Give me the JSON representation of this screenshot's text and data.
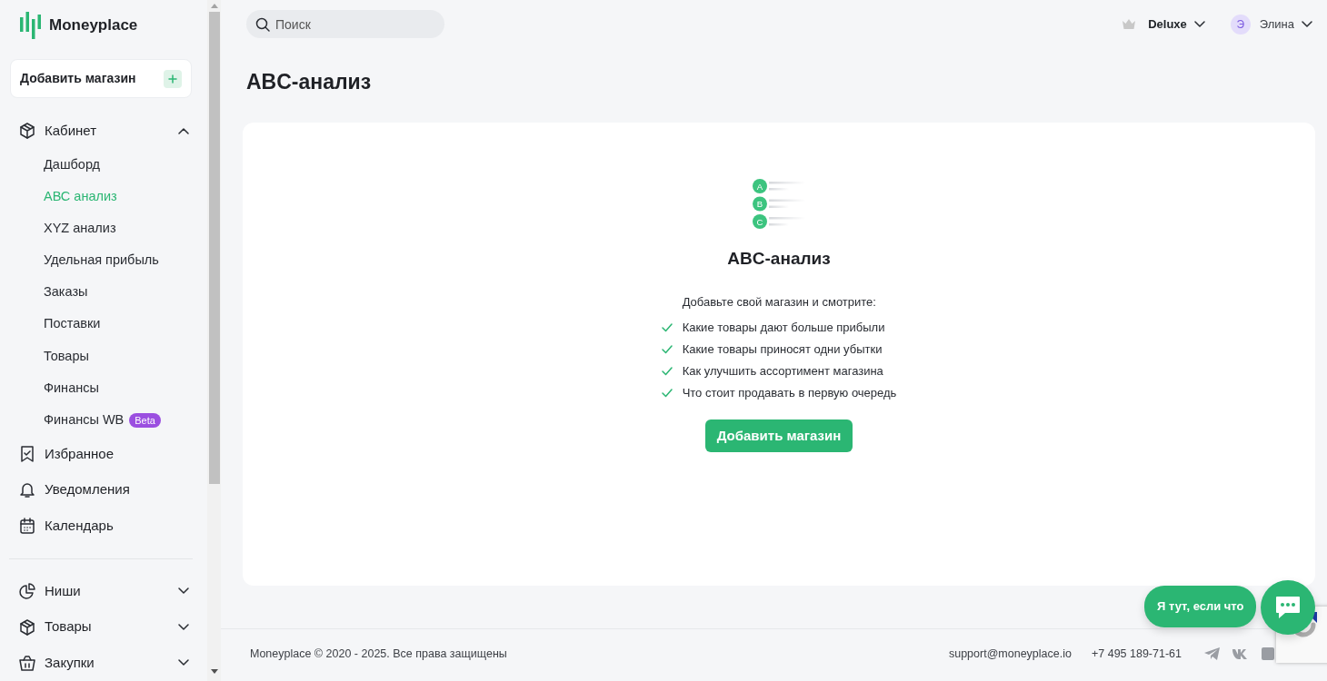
{
  "sidebar": {
    "logo": "Moneyplace",
    "add_store_button": "Добавить магазин",
    "nav_top": [
      {
        "label": "Кабинет",
        "kind": "group",
        "expanded": true,
        "children": [
          {
            "label": "Дашборд",
            "selected": false
          },
          {
            "label": "АВС анализ",
            "selected": true
          },
          {
            "label": "XYZ анализ",
            "selected": false
          },
          {
            "label": "Удельная прибыль",
            "selected": false
          },
          {
            "label": "Заказы",
            "selected": false
          },
          {
            "label": "Поставки",
            "selected": false
          },
          {
            "label": "Товары",
            "selected": false
          },
          {
            "label": "Финансы",
            "selected": false
          },
          {
            "label": "Финансы WB",
            "badge": "Beta",
            "selected": false
          }
        ]
      },
      {
        "label": "Избранное",
        "kind": "link"
      },
      {
        "label": "Уведомления",
        "kind": "link"
      },
      {
        "label": "Календарь",
        "kind": "link"
      }
    ],
    "nav_bottom": [
      {
        "label": "Ниши",
        "kind": "group",
        "expanded": false
      },
      {
        "label": "Товары",
        "kind": "group",
        "expanded": false
      },
      {
        "label": "Закупки",
        "kind": "group",
        "expanded": false
      }
    ]
  },
  "topbar": {
    "search": {
      "placeholder": "Поиск"
    },
    "plan": "Deluxe",
    "avatar": "Э",
    "user": "Элина"
  },
  "page_title": "ABC-анализ",
  "empty_state": {
    "title": "ABC-анализ",
    "intro": "Добавьте свой магазин и смотрите:",
    "features": [
      "Какие товары дают больше прибыли",
      "Какие товары приносят одни убытки",
      "Как улучшить ассортимент магазина",
      "Что стоит продавать в первую очередь"
    ],
    "button": "Добавить магазин",
    "illustration_letters": [
      "A",
      "B",
      "C"
    ]
  },
  "chat": {
    "label": "Я тут, если что"
  },
  "footer": {
    "copyright": "Moneyplace © 2020 - 2025. Все права защищены",
    "email": "support@moneyplace.io",
    "phone": "+7 495 189-71-61"
  }
}
